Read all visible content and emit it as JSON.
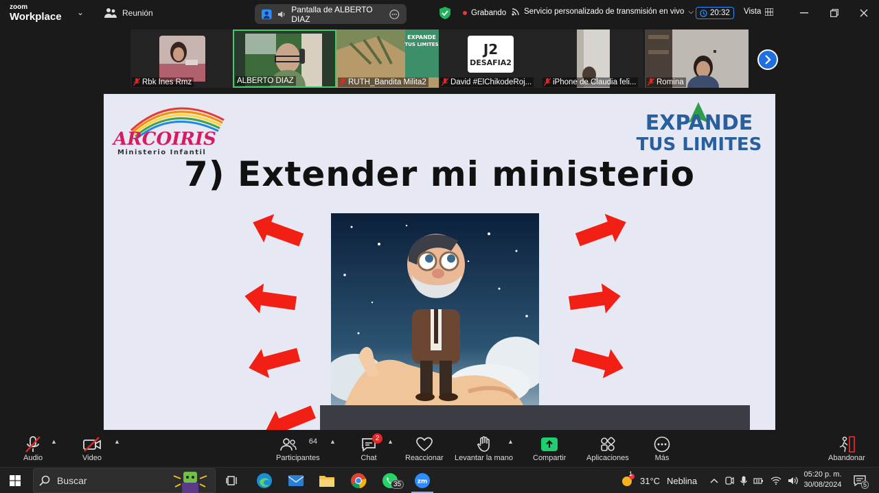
{
  "titlebar": {
    "brand_small": "zoom",
    "brand_big": "Workplace",
    "meeting_label": "Reunión",
    "share_label": "Pantalla de ALBERTO DIAZ",
    "recording_label": "Grabando",
    "stream_label": "Servicio personalizado de transmisión en vivo",
    "timer": "20:32",
    "view_label": "Vista"
  },
  "participants": [
    {
      "name": "Rbk Ines Rmz",
      "muted": true
    },
    {
      "name": "ALBERTO DIAZ",
      "muted": false
    },
    {
      "name": "RUTH_Bandita Milita2",
      "muted": true
    },
    {
      "name": "David #ElChikodeRoj...",
      "muted": true
    },
    {
      "name": "iPhone de Claudia feli...",
      "muted": true
    },
    {
      "name": "Romina",
      "muted": true
    }
  ],
  "slide": {
    "title": "7) Extender mi ministerio",
    "logo_left_text": "Ministerio Infantil",
    "logo_left_brand": "ARCOIRIS",
    "logo_right_line1": "EXPANDE",
    "logo_right_line2": "TUS LIMITES",
    "logo_right_badge_1": "J2",
    "logo_right_badge_2": "DESAFIA2"
  },
  "controls": {
    "audio": "Audio",
    "video": "Video",
    "participants": "Participantes",
    "participants_count": "64",
    "chat": "Chat",
    "chat_badge": "2",
    "react": "Reaccionar",
    "raise_hand": "Levantar la mano",
    "share": "Compartir",
    "apps": "Aplicaciones",
    "more": "Más",
    "leave": "Abandonar"
  },
  "taskbar": {
    "search_placeholder": "Buscar",
    "whatsapp_badge": "35",
    "weather_temp": "31°C",
    "weather_text": "Neblina",
    "weather_badge": "1",
    "time": "05:20 p. m.",
    "date": "30/08/2024",
    "notif_badge": "5"
  },
  "colors": {
    "accent_blue": "#2d8cff",
    "active_green": "#3ecf6a",
    "share_green": "#1fcf6f",
    "muted_red": "#e02828",
    "arrow_red": "#f21f14",
    "expande_blue": "#2a5f9e",
    "expande_green": "#2e9e4a"
  }
}
